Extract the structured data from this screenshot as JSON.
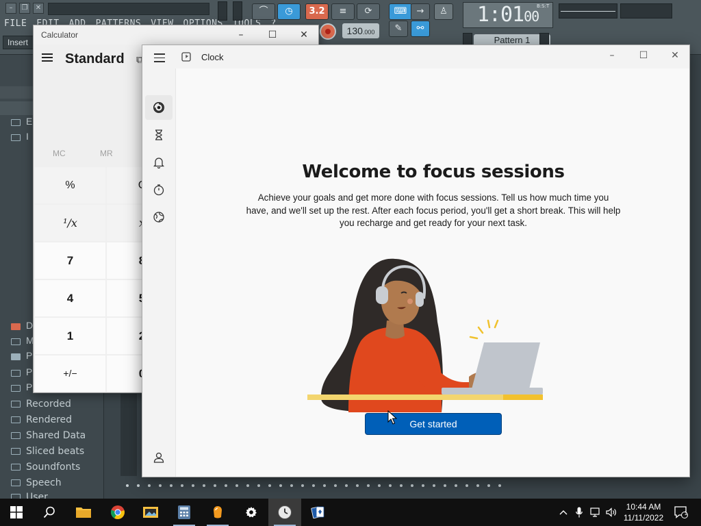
{
  "fl_studio": {
    "menu": [
      "FILE",
      "EDIT",
      "ADD",
      "PATTERNS",
      "VIEW",
      "OPTIONS",
      "TOOLS",
      "?"
    ],
    "insert_label": "Insert",
    "tempo_value": "130",
    "tempo_decimal": ".000",
    "time_display": "1:01",
    "time_display_small": "00",
    "time_unit": "B:S:T",
    "pattern_label": "Pattern 1",
    "snap_value": "3.2",
    "browser_fragments": [
      "E",
      "I",
      "D",
      "M",
      "P",
      "P",
      "P"
    ],
    "browser_items": [
      "Recorded",
      "Rendered",
      "Shared Data",
      "Sliced beats",
      "Soundfonts",
      "Speech",
      "User"
    ]
  },
  "calculator": {
    "title": "Calculator",
    "mode": "Standard",
    "memory": [
      "MC",
      "MR"
    ],
    "keys": {
      "percent": "%",
      "ce_partial": "C",
      "reciprocal": "¹/x",
      "square_partial": "x",
      "seven": "7",
      "eight_partial": "8",
      "four": "4",
      "five_partial": "5",
      "one": "1",
      "two_partial": "2",
      "negate": "+/−",
      "zero_partial": "0"
    }
  },
  "clock": {
    "title": "Clock",
    "heading": "Welcome to focus sessions",
    "description": "Achieve your goals and get more done with focus sessions. Tell us how much time you have, and we'll set up the rest. After each focus period, you'll get a short break. This will help you recharge and get ready for your next task.",
    "button_label": "Get started",
    "nav_items": [
      "focus-sessions",
      "timer",
      "alarm",
      "stopwatch",
      "world-clock"
    ],
    "active_nav": "focus-sessions",
    "accent_color": "#005fb8"
  },
  "taskbar": {
    "apps": [
      "start",
      "search",
      "file-explorer",
      "chrome",
      "photos",
      "calculator",
      "fl-studio",
      "settings",
      "clock",
      "solitaire"
    ],
    "time": "10:44 AM",
    "date": "11/11/2022",
    "notification_count": "1"
  }
}
